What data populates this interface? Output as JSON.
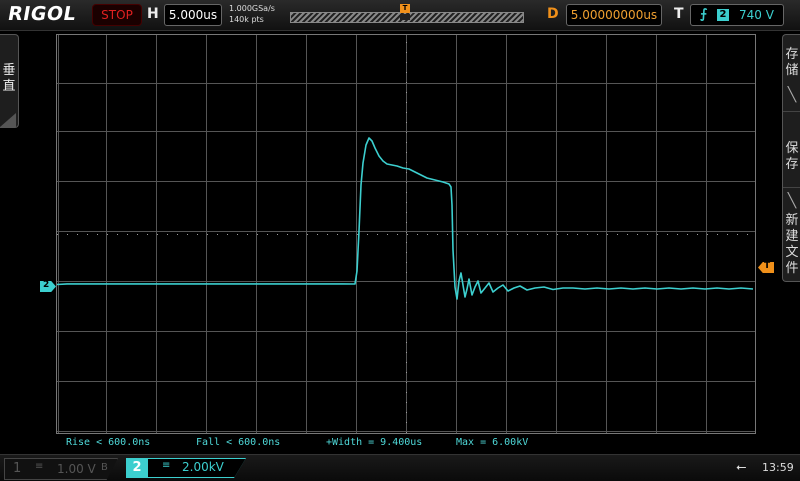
{
  "header": {
    "brand": "RIGOL",
    "run_state": "STOP",
    "horizontal": {
      "label": "H",
      "scale": "5.000us"
    },
    "sample_rate": "1.000GSa/s",
    "memory_depth": "140k pts",
    "trigger_pos_marker": "T",
    "delay": {
      "label": "D",
      "value": "5.00000000us"
    },
    "trigger": {
      "label": "T",
      "edge_icon": "rising-edge-icon",
      "source": "2",
      "level": "740 V"
    }
  },
  "left_tab": {
    "label": "垂直"
  },
  "right_menu": [
    {
      "label": "存储"
    },
    {
      "label": "保存"
    },
    {
      "label": "新建文件"
    }
  ],
  "markers": {
    "channel2_ref": "2",
    "trigger_level": "T"
  },
  "measurements": [
    {
      "text": "Rise < 600.0ns"
    },
    {
      "text": "Fall < 600.0ns"
    },
    {
      "text": "+Width = 9.400us"
    },
    {
      "text": "Max = 6.00kV"
    }
  ],
  "footer": {
    "ch1": {
      "num": "1",
      "coupling": "≡",
      "scale": "1.00 V",
      "bw": "B"
    },
    "ch2": {
      "num": "2",
      "coupling": "≡",
      "scale": "2.00kV"
    },
    "usb_icon": "usb-icon",
    "time": "13:59"
  },
  "colors": {
    "ch2": "#3ccfcf",
    "trigger": "#f0901a",
    "stop": "#e02020"
  }
}
